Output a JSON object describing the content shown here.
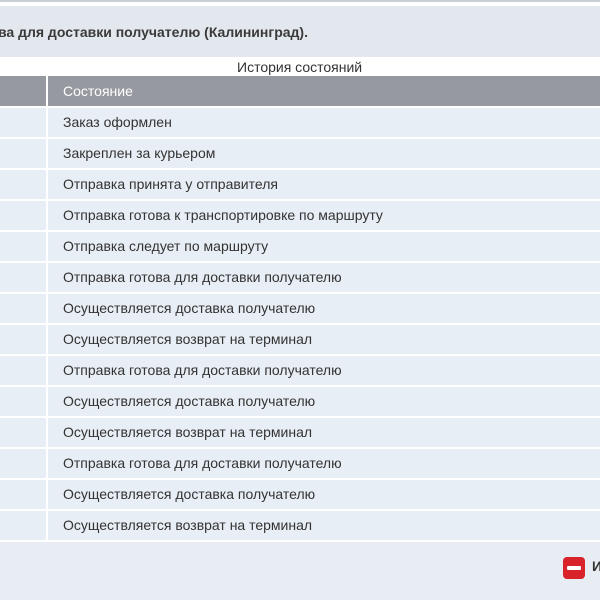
{
  "header": {
    "title": "ва для доставки получателю (Калининград)."
  },
  "table": {
    "caption": "История состояний",
    "column_state": "Состояние",
    "rows": [
      "Заказ оформлен",
      "Закреплен за курьером",
      "Отправка принята у отправителя",
      "Отправка готова к транспортировке по маршруту",
      "Отправка следует по маршруту",
      "Отправка готова для доставки получателю",
      "Осуществляется доставка получателю",
      "Осуществляется возврат на терминал",
      "Отправка готова для доставки получателю",
      "Осуществляется доставка получателю",
      "Осуществляется возврат на терминал",
      "Отправка готова для доставки получателю",
      "Осуществляется доставка получателю",
      "Осуществляется возврат на терминал"
    ]
  },
  "footer": {
    "link_text": "И",
    "icon": "stop-icon",
    "icon_color": "#d8232a"
  }
}
